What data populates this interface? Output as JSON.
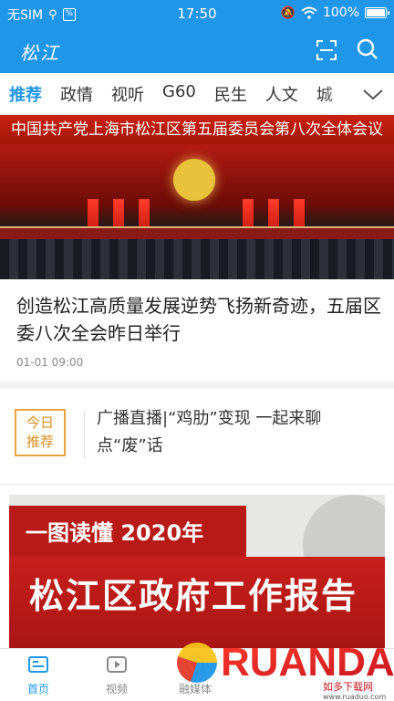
{
  "status_bar": {
    "carrier": "无SIM",
    "time": "17:50",
    "battery": "100%"
  },
  "app": {
    "logo": "松江"
  },
  "tabs": [
    "推荐",
    "政情",
    "视听",
    "G60",
    "民生",
    "人文",
    "城"
  ],
  "hero": {
    "banner": "中国共产党上海市松江区第五届委员会第八次全体会议"
  },
  "article": {
    "title": "创造松江高质量发展逆势飞扬新奇迹，五届区委八次全会昨日举行",
    "time": "01-01 09:00"
  },
  "recommend": {
    "badge_line1": "今日",
    "badge_line2": "推荐",
    "text": "广播直播|“鸡肋”变现  一起来聊点“废”话"
  },
  "feature": {
    "line1": "一图读懂 2020年",
    "line2": "松江区政府工作报告"
  },
  "bottom_nav": [
    "首页",
    "视频",
    "融媒体"
  ],
  "watermark": {
    "brand": "RUANDAO",
    "sub": "如多下载网",
    "url": "www.ruaduo.com"
  },
  "colors": {
    "primary": "#1f96e8",
    "accent_red": "#c71f1c",
    "badge_orange": "#e8a33c"
  }
}
